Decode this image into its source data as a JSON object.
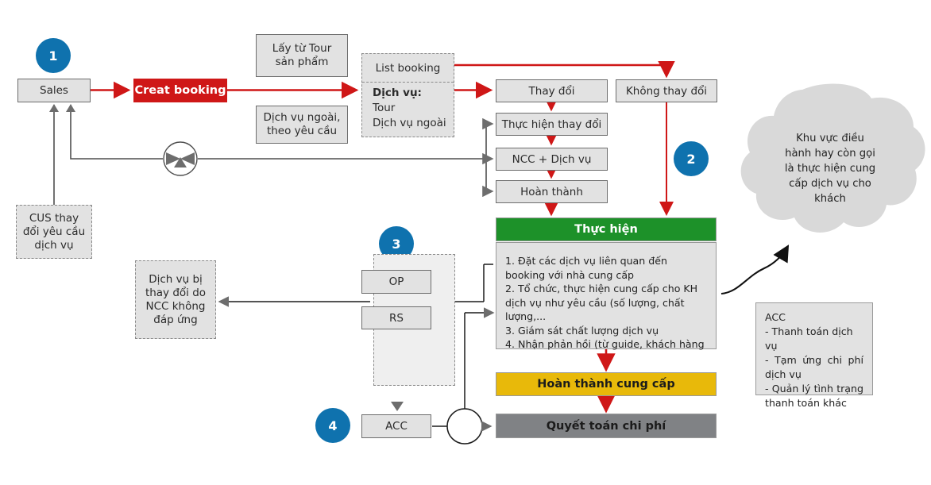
{
  "colors": {
    "accent_blue": "#0f72ae",
    "red": "#cf1717",
    "green": "#1d9129",
    "yellow": "#e8b90a",
    "slate": "#808285",
    "box_gray": "#e2e2e2"
  },
  "badges": [
    {
      "name": "badge-1",
      "label": "1"
    },
    {
      "name": "badge-2",
      "label": "2"
    },
    {
      "name": "badge-3",
      "label": "3"
    },
    {
      "name": "badge-4",
      "label": "4"
    }
  ],
  "nodes": {
    "sales": "Sales",
    "creat_booking": "Creat booking",
    "lay_tu_tour_l1": "Lấy từ Tour",
    "lay_tu_tour_l2": "sản phẩm",
    "dich_vu_ngoai_l1": "Dịch vụ ngoài,",
    "dich_vu_ngoai_l2": "theo yêu cầu",
    "list_booking": "List booking",
    "dich_vu_label": "Dịch vụ:",
    "dich_vu_item1": "Tour",
    "dich_vu_item2": "Dịch vụ ngoài",
    "thay_doi": "Thay đổi",
    "khong_thay_doi": "Không thay đổi",
    "thuc_hien_thay_doi": "Thực hiện thay đổi",
    "ncc_dich_vu": "NCC + Dịch vụ",
    "hoan_thanh": "Hoàn thành",
    "thuc_hien_header": "Thực hiện",
    "hoan_thanh_cung_cap": "Hoàn thành cung cấp",
    "quyet_toan_chi_phi": "Quyết toán chi phí",
    "op": "OP",
    "rs": "RS",
    "acc": "ACC",
    "cus_thay_doi_l1": "CUS thay",
    "cus_thay_doi_l2": "đổi yêu cầu",
    "cus_thay_doi_l3": "dịch vụ",
    "dich_vu_bi_l1": "Dịch vụ bị",
    "dich_vu_bi_l2": "thay đổi do",
    "dich_vu_bi_l3": "NCC không",
    "dich_vu_bi_l4": "đáp ứng"
  },
  "thuc_hien_steps": [
    "1. Đặt các dịch vụ liên quan đến booking với nhà cung cấp",
    "2. Tổ chức, thực hiện cung cấp cho KH dịch vụ như yêu cầu (số lượng, chất lượng,...",
    "3. Giám sát chất lượng dịch vụ",
    "4. Nhận phản hồi (từ guide, khách hàng"
  ],
  "cloud": {
    "lines": [
      "Khu vực điều",
      "hành hay còn gọi",
      "là thực hiện cung",
      "cấp dịch vụ cho",
      "khách"
    ]
  },
  "acc_note": {
    "title": "ACC",
    "lines": [
      "- Thanh toán dịch vụ",
      "- Tạm ứng chi phí dịch vụ",
      "- Quản lý tình trạng thanh toán khác"
    ]
  }
}
